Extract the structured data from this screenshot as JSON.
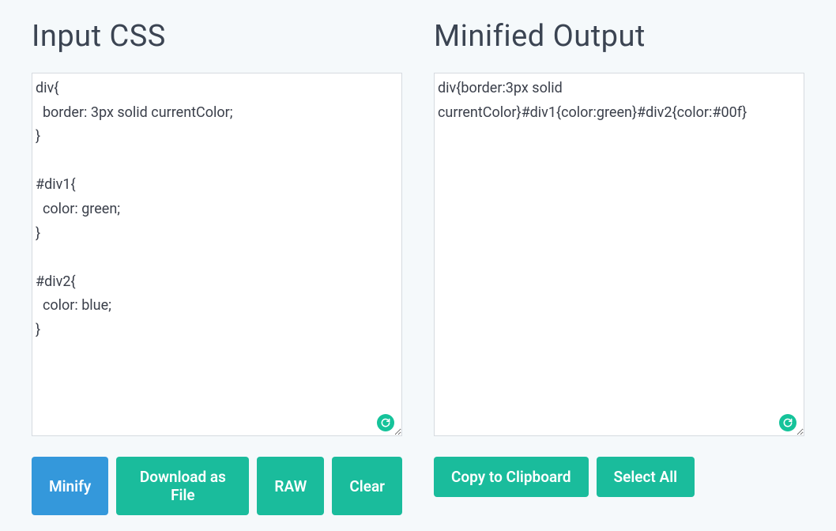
{
  "input": {
    "title": "Input CSS",
    "value": "div{\n  border: 3px solid currentColor;\n}\n\n#div1{\n  color: green;\n}\n\n#div2{\n  color: blue;\n}",
    "buttons": {
      "minify": "Minify",
      "download": "Download as File",
      "raw": "RAW",
      "clear": "Clear"
    }
  },
  "output": {
    "title": "Minified Output",
    "value": "div{border:3px solid currentColor}#div1{color:green}#div2{color:#00f}",
    "buttons": {
      "copy": "Copy to Clipboard",
      "select_all": "Select All"
    }
  }
}
